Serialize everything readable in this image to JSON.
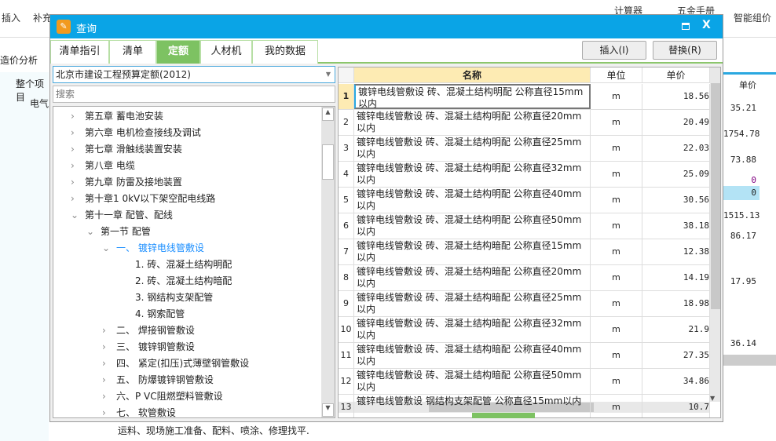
{
  "background": {
    "toolbar": [
      "插入",
      "补充",
      "计算器",
      "五金手册",
      "智能组价"
    ],
    "tab": "造价分析",
    "tree": [
      "整个项目",
      "电气"
    ],
    "col_header": "单价",
    "values": [
      "35.21",
      "1754.78",
      "73.88",
      "0",
      "0",
      "1515.13",
      "86.17",
      "17.95",
      "36.14"
    ],
    "bottom_text": "运料、现场施工准备、配料、喷涂、修理找平."
  },
  "dialog": {
    "title": "查询",
    "tabs": [
      "清单指引",
      "清单",
      "定额",
      "人材机",
      "我的数据"
    ],
    "active_tab": "定额",
    "insert_button": "插入(I)",
    "replace_button": "替换(R)",
    "library": "北京市建设工程预算定额(2012)",
    "search_placeholder": "搜索",
    "tree": [
      {
        "label": "第五章  蓄电池安装",
        "level": 0,
        "state": "collapsed"
      },
      {
        "label": "第六章  电机检查接线及调试",
        "level": 0,
        "state": "collapsed"
      },
      {
        "label": "第七章  滑触线装置安装",
        "level": 0,
        "state": "collapsed"
      },
      {
        "label": "第八章  电缆",
        "level": 0,
        "state": "collapsed"
      },
      {
        "label": "第九章  防雷及接地装置",
        "level": 0,
        "state": "collapsed"
      },
      {
        "label": "第十章1 0kV以下架空配电线路",
        "level": 0,
        "state": "collapsed"
      },
      {
        "label": "第十一章  配管、配线",
        "level": 0,
        "state": "expanded"
      },
      {
        "label": "第一节  配管",
        "level": 1,
        "state": "expanded"
      },
      {
        "label": "一、  镀锌电线管敷设",
        "level": 2,
        "state": "expanded",
        "selected": true
      },
      {
        "label": "1.  砖、混凝土结构明配",
        "level": 3,
        "state": "leaf"
      },
      {
        "label": "2.  砖、混凝土结构暗配",
        "level": 3,
        "state": "leaf"
      },
      {
        "label": "3.  钢结构支架配管",
        "level": 3,
        "state": "leaf"
      },
      {
        "label": "4.  钢索配管",
        "level": 3,
        "state": "leaf"
      },
      {
        "label": "二、  焊接钢管敷设",
        "level": 2,
        "state": "collapsed"
      },
      {
        "label": "三、  镀锌钢管敷设",
        "level": 2,
        "state": "collapsed"
      },
      {
        "label": "四、  紧定(扣压)式薄壁钢管敷设",
        "level": 2,
        "state": "collapsed"
      },
      {
        "label": "五、  防爆镀锌钢管敷设",
        "level": 2,
        "state": "collapsed"
      },
      {
        "label": "六、P VC阻燃塑料管敷设",
        "level": 2,
        "state": "collapsed"
      },
      {
        "label": "七、  软管敷设",
        "level": 2,
        "state": "collapsed"
      }
    ],
    "columns": [
      "名称",
      "单位",
      "单价"
    ],
    "rows": [
      {
        "n": "1",
        "name": "镀锌电线管敷设 砖、混凝土结构明配 公称直径15mm以内",
        "unit": "m",
        "price": "18.56"
      },
      {
        "n": "2",
        "name": "镀锌电线管敷设 砖、混凝土结构明配 公称直径20mm以内",
        "unit": "m",
        "price": "20.49"
      },
      {
        "n": "3",
        "name": "镀锌电线管敷设 砖、混凝土结构明配 公称直径25mm以内",
        "unit": "m",
        "price": "22.03"
      },
      {
        "n": "4",
        "name": "镀锌电线管敷设 砖、混凝土结构明配 公称直径32mm以内",
        "unit": "m",
        "price": "25.09"
      },
      {
        "n": "5",
        "name": "镀锌电线管敷设 砖、混凝土结构明配 公称直径40mm以内",
        "unit": "m",
        "price": "30.56"
      },
      {
        "n": "6",
        "name": "镀锌电线管敷设 砖、混凝土结构明配 公称直径50mm以内",
        "unit": "m",
        "price": "38.18"
      },
      {
        "n": "7",
        "name": "镀锌电线管敷设 砖、混凝土结构暗配 公称直径15mm以内",
        "unit": "m",
        "price": "12.38"
      },
      {
        "n": "8",
        "name": "镀锌电线管敷设 砖、混凝土结构暗配 公称直径20mm以内",
        "unit": "m",
        "price": "14.19"
      },
      {
        "n": "9",
        "name": "镀锌电线管敷设 砖、混凝土结构暗配 公称直径25mm以内",
        "unit": "m",
        "price": "18.98"
      },
      {
        "n": "10",
        "name": "镀锌电线管敷设 砖、混凝土结构暗配 公称直径32mm以内",
        "unit": "m",
        "price": "21.9"
      },
      {
        "n": "11",
        "name": "镀锌电线管敷设 砖、混凝土结构暗配 公称直径40mm以内",
        "unit": "m",
        "price": "27.35"
      },
      {
        "n": "12",
        "name": "镀锌电线管敷设 砖、混凝土结构暗配 公称直径50mm以内",
        "unit": "m",
        "price": "34.86"
      },
      {
        "n": "13",
        "name": "镀锌电线管敷设 钢结构支架配管 公称直径15mm以内",
        "unit": "m",
        "price": "10.7"
      }
    ]
  }
}
